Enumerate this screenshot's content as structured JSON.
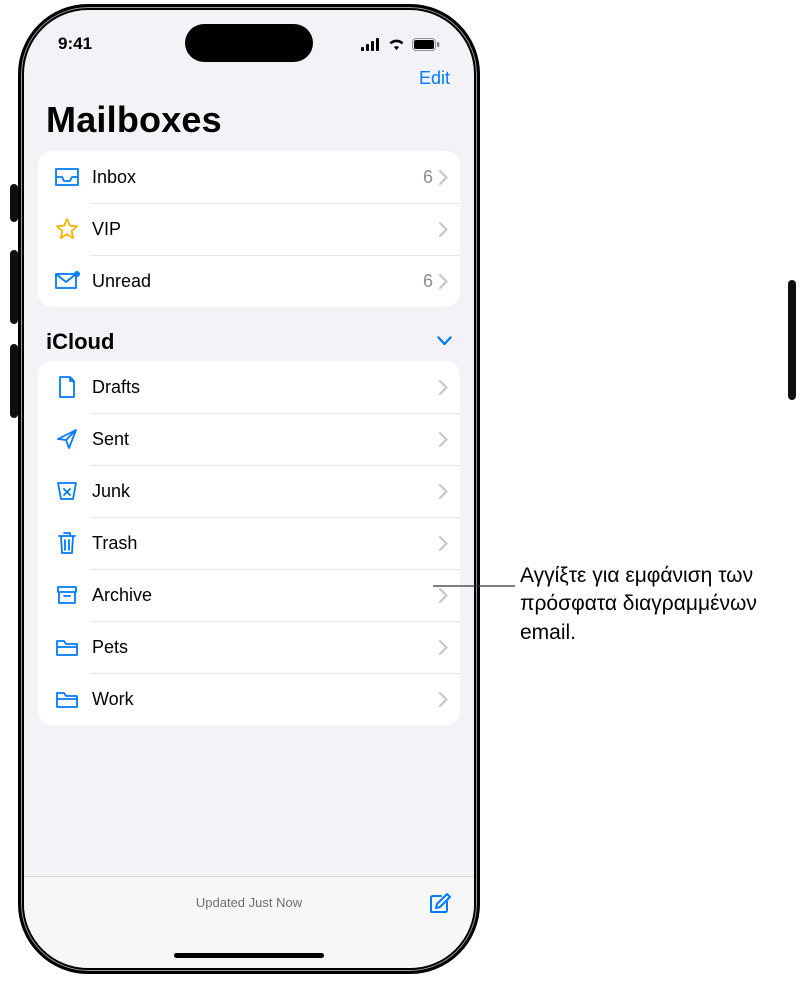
{
  "status": {
    "time": "9:41"
  },
  "nav": {
    "edit": "Edit"
  },
  "title": "Mailboxes",
  "smart": {
    "inbox": {
      "label": "Inbox",
      "count": "6"
    },
    "vip": {
      "label": "VIP"
    },
    "unread": {
      "label": "Unread",
      "count": "6"
    }
  },
  "section": {
    "icloud": "iCloud"
  },
  "icloud": {
    "drafts": {
      "label": "Drafts"
    },
    "sent": {
      "label": "Sent"
    },
    "junk": {
      "label": "Junk"
    },
    "trash": {
      "label": "Trash"
    },
    "archive": {
      "label": "Archive"
    },
    "pets": {
      "label": "Pets"
    },
    "work": {
      "label": "Work"
    }
  },
  "footer": {
    "updated": "Updated Just Now"
  },
  "callout": {
    "text": "Αγγίξτε για εμφάνιση των πρόσφατα διαγραμμένων email."
  }
}
